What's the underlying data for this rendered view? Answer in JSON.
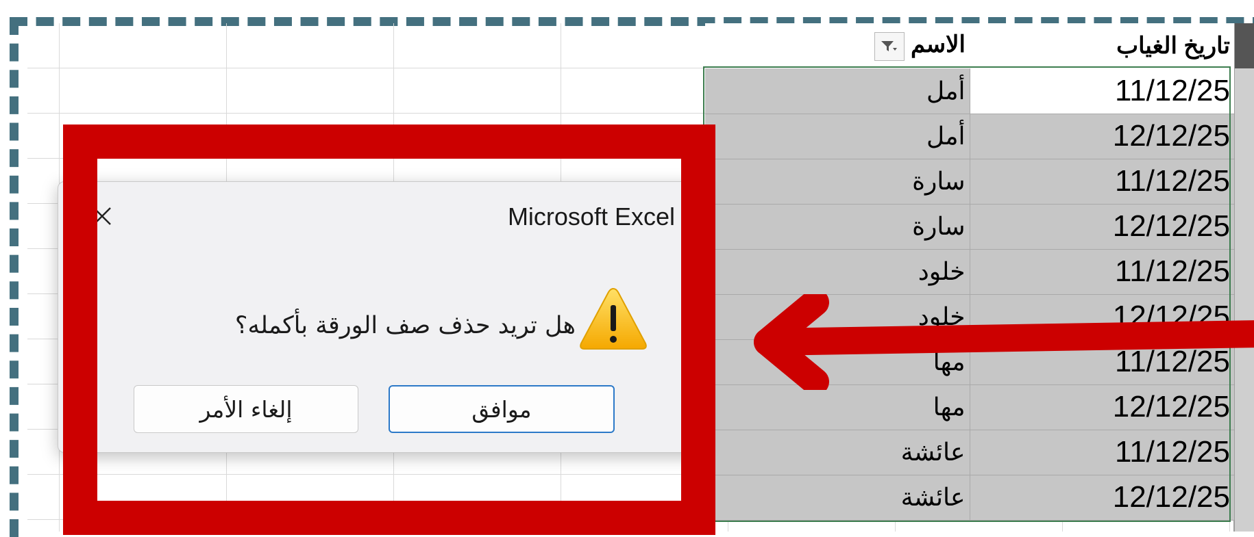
{
  "sheet": {
    "header": {
      "name_label": "الاسم",
      "date_label": "تاريخ الغياب"
    },
    "rows": [
      {
        "name": "أمل",
        "date": "11/12/25"
      },
      {
        "name": "أمل",
        "date": "12/12/25"
      },
      {
        "name": "سارة",
        "date": "11/12/25"
      },
      {
        "name": "سارة",
        "date": "12/12/25"
      },
      {
        "name": "خلود",
        "date": "11/12/25"
      },
      {
        "name": "خلود",
        "date": "12/12/25"
      },
      {
        "name": "مها",
        "date": "11/12/25"
      },
      {
        "name": "مها",
        "date": "12/12/25"
      },
      {
        "name": "عائشة",
        "date": "11/12/25"
      },
      {
        "name": "عائشة",
        "date": "12/12/25"
      }
    ]
  },
  "dialog": {
    "title": "Microsoft Excel",
    "message": "هل تريد حذف صف الورقة بأكمله؟",
    "ok_label": "موافق",
    "cancel_label": "إلغاء الأمر",
    "icon": "warning-icon"
  },
  "annotation": {
    "frame_color": "#44707f",
    "highlight_color": "#cc0000",
    "arrow_color": "#cc0000"
  }
}
